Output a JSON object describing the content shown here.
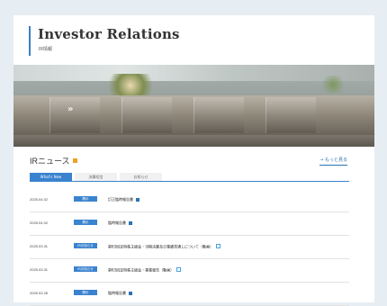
{
  "header": {
    "title": "Investor Relations",
    "subtitle": "IR情報"
  },
  "hero": {
    "logo_text": "»"
  },
  "news": {
    "title": "IRニュース",
    "more_link": "→ もっと見る",
    "tabs": [
      {
        "label": "What's New",
        "active": true
      },
      {
        "label": "決算短信",
        "active": false
      },
      {
        "label": "お知らせ",
        "active": false
      }
    ],
    "items": [
      {
        "date": "2025.04.02",
        "category": "開示",
        "title": "訂正臨時報告書",
        "icon": "pdf-icon"
      },
      {
        "date": "2025.04.02",
        "category": "開示",
        "title": "臨時報告書",
        "icon": "pdf-icon"
      },
      {
        "date": "2025.03.31",
        "category": "IRお知らせ",
        "title": "第63回定時株主総会・当期決算及び業績見通しについて（動画）",
        "icon": "external-link-icon"
      },
      {
        "date": "2025.03.31",
        "category": "IRお知らせ",
        "title": "第63回定時株主総会・事業報告（動画）",
        "icon": "external-link-icon"
      },
      {
        "date": "2025.03.28",
        "category": "開示",
        "title": "臨時報告書",
        "icon": "pdf-icon"
      }
    ]
  },
  "colors": {
    "accent": "#3a83cf",
    "rss": "#f0a020",
    "background": "#e6edf3"
  }
}
